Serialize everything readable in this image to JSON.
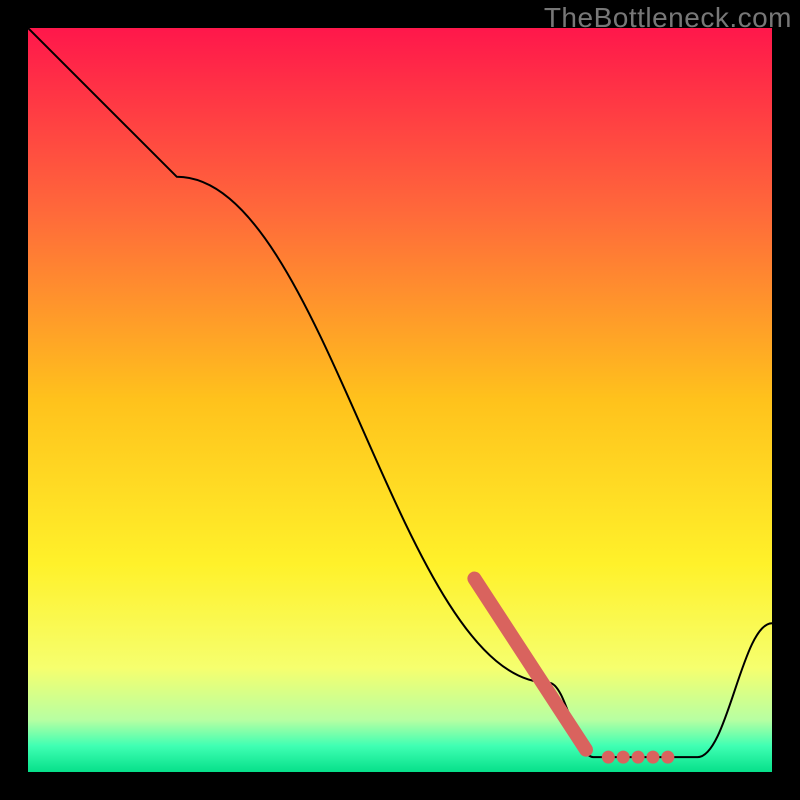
{
  "watermark": "TheBottleneck.com",
  "chart_data": {
    "type": "line",
    "title": "",
    "xlabel": "",
    "ylabel": "",
    "xlim": [
      0,
      100
    ],
    "ylim": [
      0,
      100
    ],
    "grid": false,
    "legend": false,
    "series": [
      {
        "name": "curve",
        "color": "#000000",
        "x": [
          0,
          20,
          70,
          76,
          90,
          100
        ],
        "y": [
          100,
          80,
          12,
          2,
          2,
          20
        ]
      },
      {
        "name": "highlight",
        "color": "#d9635e",
        "x": [
          60,
          72,
          75,
          78,
          80,
          82,
          84,
          86
        ],
        "y": [
          26,
          7,
          3,
          2,
          2,
          2,
          2,
          2
        ]
      }
    ],
    "gradient_stops": [
      {
        "offset": 0.0,
        "color": "#ff174b"
      },
      {
        "offset": 0.25,
        "color": "#ff6a3a"
      },
      {
        "offset": 0.5,
        "color": "#ffc21c"
      },
      {
        "offset": 0.72,
        "color": "#fff12a"
      },
      {
        "offset": 0.86,
        "color": "#f6ff6e"
      },
      {
        "offset": 0.93,
        "color": "#b7ffa2"
      },
      {
        "offset": 0.965,
        "color": "#3fffb3"
      },
      {
        "offset": 1.0,
        "color": "#06e08a"
      }
    ]
  }
}
